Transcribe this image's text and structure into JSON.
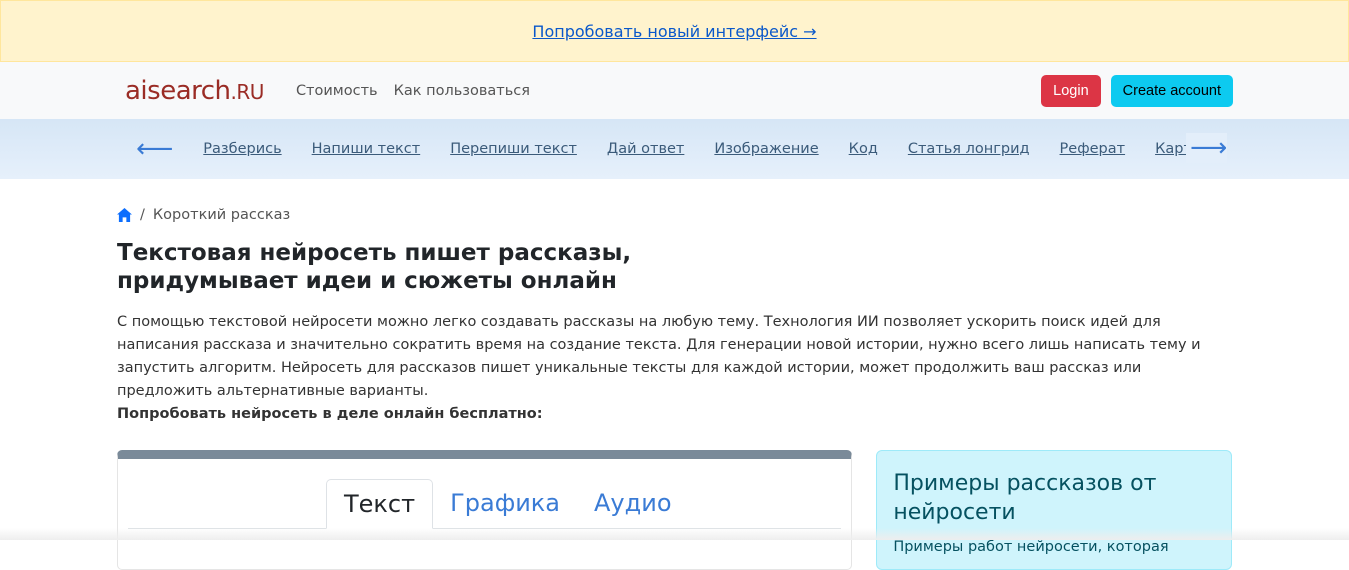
{
  "banner": {
    "link": "Попробовать новый интерфейс →"
  },
  "header": {
    "logo": "aisearch",
    "logo_suffix": ".RU",
    "links": [
      "Стоимость",
      "Как пользоваться"
    ],
    "login": "Login",
    "create_account": "Create account"
  },
  "categories": {
    "items": [
      "Разберись",
      "Напиши текст",
      "Перепиши текст",
      "Дай ответ",
      "Изображение",
      "Код",
      "Статья лонгрид",
      "Реферат",
      "Карточка"
    ]
  },
  "breadcrumb": {
    "sep": "/",
    "current": "Короткий рассказ"
  },
  "main": {
    "title_line1": "Текстовая нейросеть пишет рассказы,",
    "title_line2": "придумывает идеи и сюжеты онлайн",
    "description": "С помощью текстовой нейросети можно легко создавать рассказы на любую тему. Технология ИИ позволяет ускорить поиск идей для написания рассказа и значительно сократить время на создание текста. Для генерации новой истории, нужно всего лишь написать тему и запустить алгоритм. Нейросеть для рассказов пишет уникальные тексты для каждой истории, может продолжить ваш рассказ или предложить альтернативные варианты.",
    "cta": "Попробовать нейросеть в деле онлайн бесплатно:",
    "tabs": [
      "Текст",
      "Графика",
      "Аудио"
    ]
  },
  "sidebar": {
    "title": "Примеры рассказов от нейросети",
    "text": "Примеры работ нейросети, которая"
  }
}
